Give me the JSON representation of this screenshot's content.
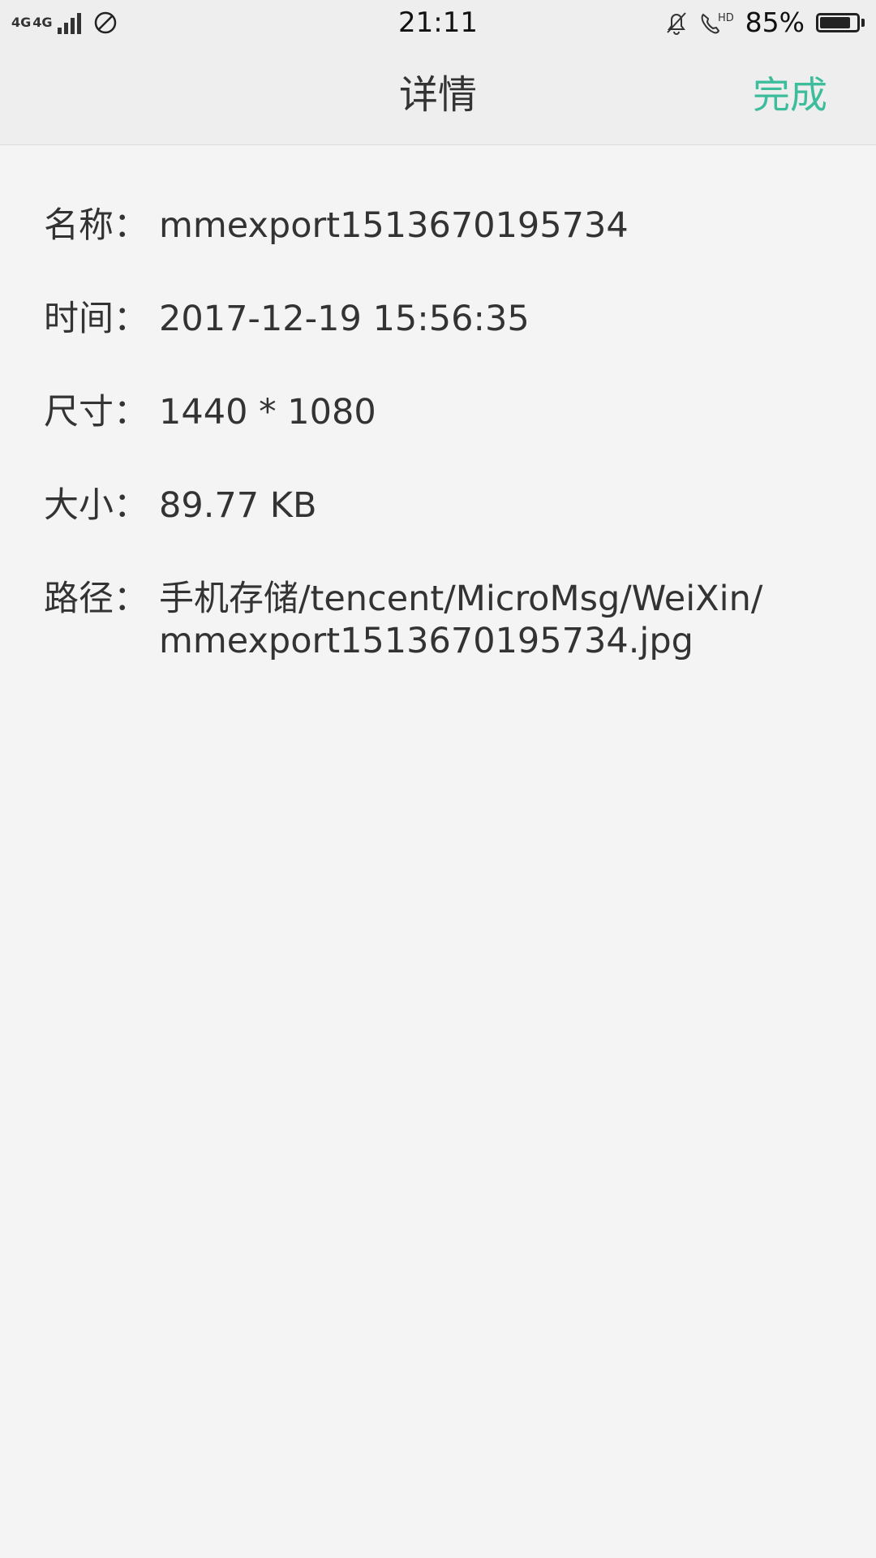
{
  "status_bar": {
    "network_1": "4G",
    "network_2": "4G",
    "time": "21:11",
    "hd_label": "HD",
    "battery_percent": "85%",
    "battery_level": 0.85,
    "icons": [
      "signal-icon",
      "dnd-icon",
      "bell-muted-icon",
      "hd-call-icon",
      "battery-icon"
    ]
  },
  "header": {
    "title": "详情",
    "done_label": "完成",
    "accent_color": "#3dbd9b"
  },
  "details": [
    {
      "label": "名称：",
      "value": "mmexport1513670195734"
    },
    {
      "label": "时间：",
      "value": "2017-12-19 15:56:35"
    },
    {
      "label": "尺寸：",
      "value": "1440 * 1080"
    },
    {
      "label": "大小：",
      "value": "89.77 KB"
    },
    {
      "label": "路径：",
      "value": "手机存储/tencent/MicroMsg/WeiXin/mmexport1513670195734.jpg"
    }
  ]
}
